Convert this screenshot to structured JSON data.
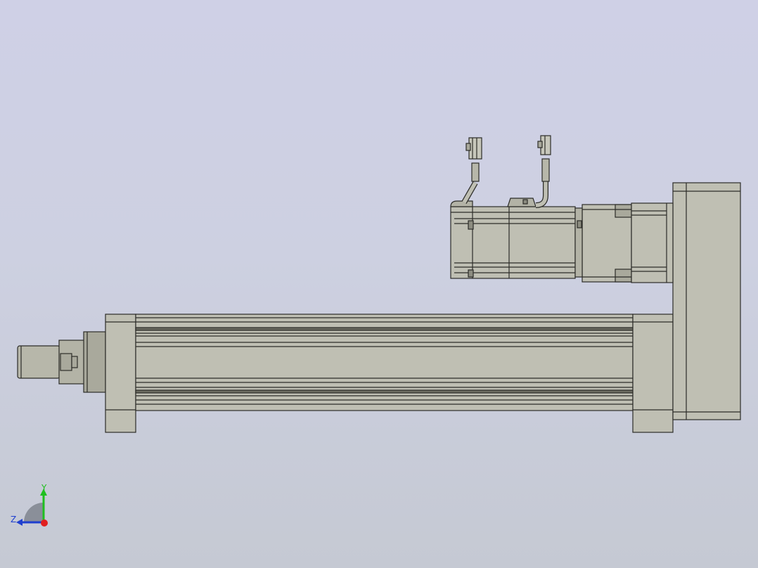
{
  "triad": {
    "y_label": "Y",
    "z_label": "Z"
  },
  "colors": {
    "background_top": "#cfd0e6",
    "background_bottom": "#c5c9d3",
    "part_fill": "#bfbfb3",
    "part_fill_dark": "#a9a99c",
    "edge": "#2c2c28",
    "axis_y": "#1fbf1f",
    "axis_z": "#1f3fcf",
    "axis_x": "#e01f1f"
  }
}
